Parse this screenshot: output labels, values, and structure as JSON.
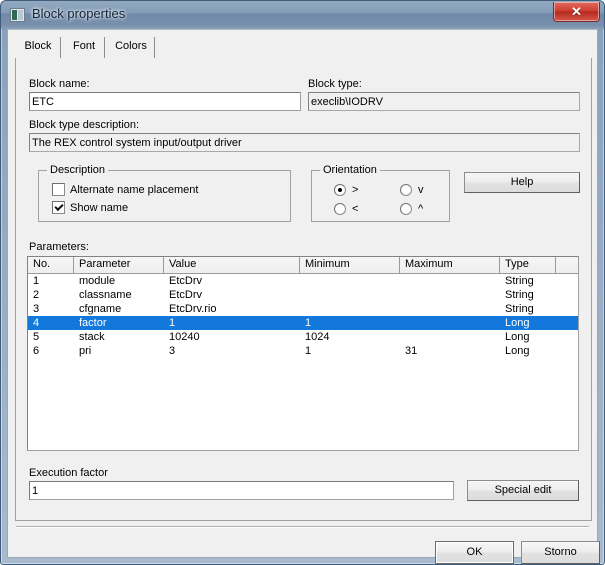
{
  "window": {
    "title": "Block properties",
    "icon": "block-icon",
    "close_label": "✕"
  },
  "tabs": [
    {
      "label": "Block",
      "active": true
    },
    {
      "label": "Font",
      "active": false
    },
    {
      "label": "Colors",
      "active": false
    }
  ],
  "form": {
    "block_name_label": "Block name:",
    "block_name_value": "ETC",
    "block_type_label": "Block type:",
    "block_type_value": "execlib\\IODRV",
    "block_type_description_label": "Block type description:",
    "block_type_description_value": "The REX control system input/output driver"
  },
  "description_group": {
    "caption": "Description",
    "alternate_name_placement_label": "Alternate name placement",
    "alternate_name_placement_checked": false,
    "show_name_label": "Show name",
    "show_name_checked": true
  },
  "orientation_group": {
    "caption": "Orientation",
    "options": [
      {
        "label": ">",
        "selected": true
      },
      {
        "label": "v",
        "selected": false
      },
      {
        "label": "<",
        "selected": false
      },
      {
        "label": "^",
        "selected": false
      }
    ]
  },
  "help_button": "Help",
  "parameters": {
    "label": "Parameters:",
    "columns": [
      "No.",
      "Parameter",
      "Value",
      "Minimum",
      "Maximum",
      "Type",
      ""
    ],
    "rows": [
      {
        "no": "1",
        "parameter": "module",
        "value": "EtcDrv",
        "minimum": "",
        "maximum": "",
        "type": "String",
        "selected": false
      },
      {
        "no": "2",
        "parameter": "classname",
        "value": "EtcDrv",
        "minimum": "",
        "maximum": "",
        "type": "String",
        "selected": false
      },
      {
        "no": "3",
        "parameter": "cfgname",
        "value": "EtcDrv.rio",
        "minimum": "",
        "maximum": "",
        "type": "String",
        "selected": false
      },
      {
        "no": "4",
        "parameter": "factor",
        "value": "1",
        "minimum": "1",
        "maximum": "",
        "type": "Long",
        "selected": true
      },
      {
        "no": "5",
        "parameter": "stack",
        "value": "10240",
        "minimum": "1024",
        "maximum": "",
        "type": "Long",
        "selected": false
      },
      {
        "no": "6",
        "parameter": "pri",
        "value": "3",
        "minimum": "1",
        "maximum": "31",
        "type": "Long",
        "selected": false
      }
    ]
  },
  "execution": {
    "label": "Execution factor",
    "value": "1",
    "special_edit_label": "Special edit"
  },
  "dialog_buttons": {
    "ok_label": "OK",
    "cancel_label": "Storno"
  },
  "colors": {
    "selection": "#1278dc",
    "titlebar": "#7c95b1",
    "close_button": "#cf4034",
    "face": "#f0f0f0"
  }
}
